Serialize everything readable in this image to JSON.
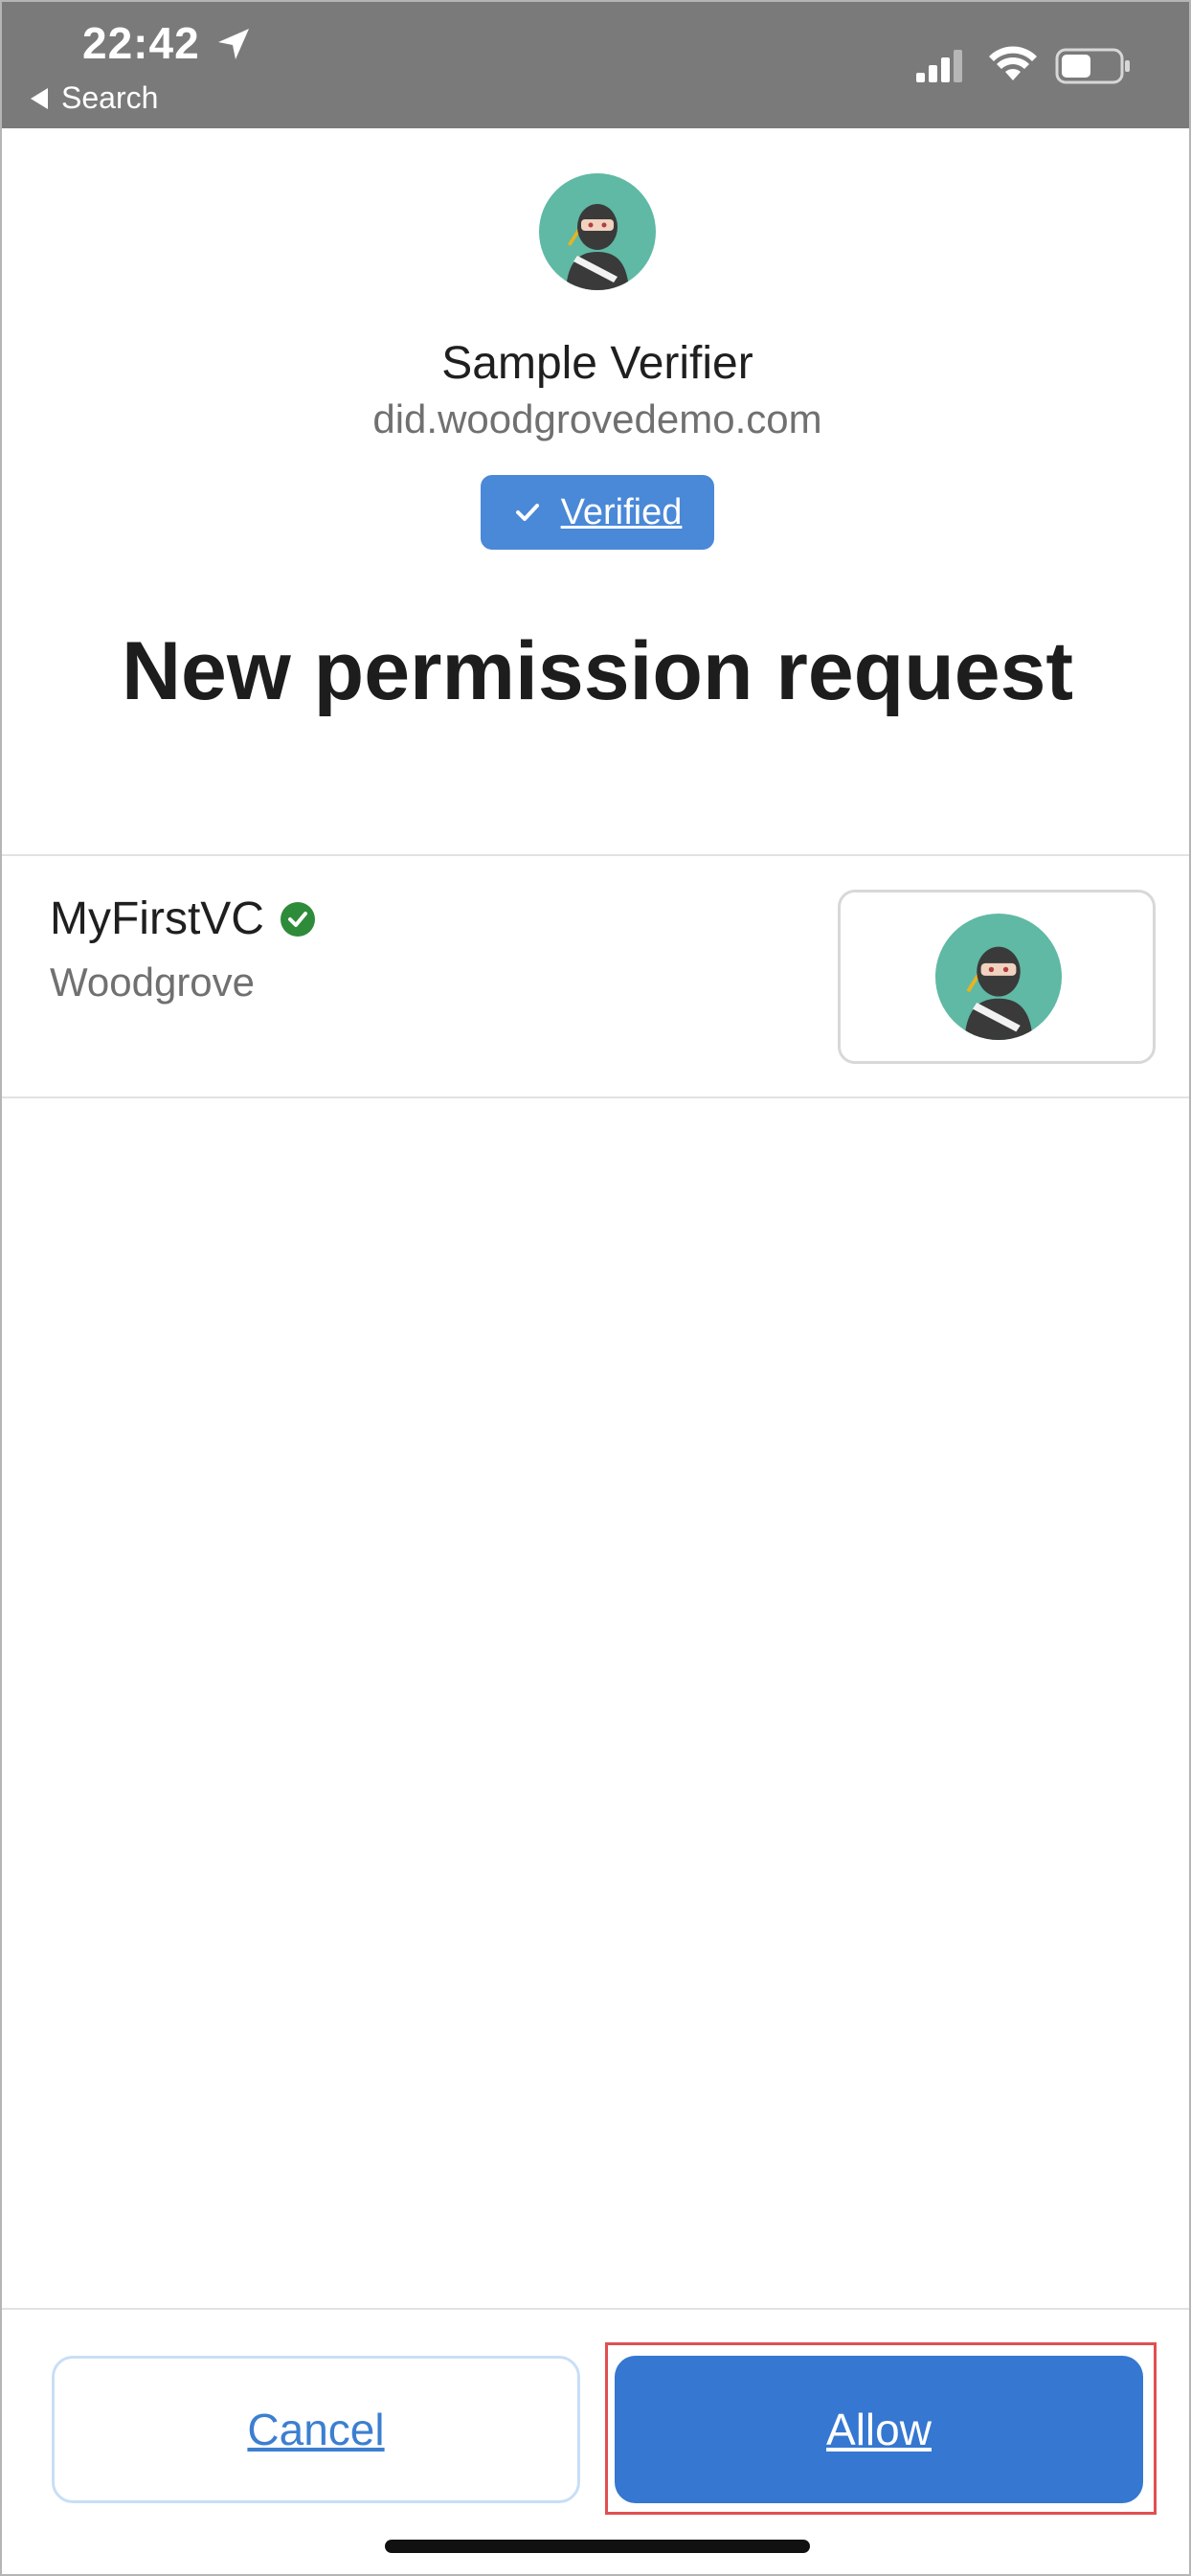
{
  "status_bar": {
    "time": "22:42",
    "back_label": "Search",
    "icons": [
      "location-arrow-icon",
      "cellular-signal-icon",
      "wifi-icon",
      "battery-icon"
    ]
  },
  "verifier": {
    "name": "Sample Verifier",
    "domain": "did.woodgrovedemo.com",
    "badge_label": "Verified",
    "logo_icon": "ninja-avatar-icon"
  },
  "page": {
    "title": "New permission request"
  },
  "credential": {
    "name": "MyFirstVC",
    "issuer": "Woodgrove",
    "status_icon": "verified-check-icon",
    "card_icon": "ninja-avatar-icon"
  },
  "actions": {
    "cancel_label": "Cancel",
    "allow_label": "Allow"
  },
  "colors": {
    "status_bar": "#7a7a7a",
    "badge": "#4a88d8",
    "primary_button": "#3577d1",
    "avatar_bg": "#5fb9a4",
    "highlight": "#e05050",
    "verified_check": "#2e8b3a"
  }
}
